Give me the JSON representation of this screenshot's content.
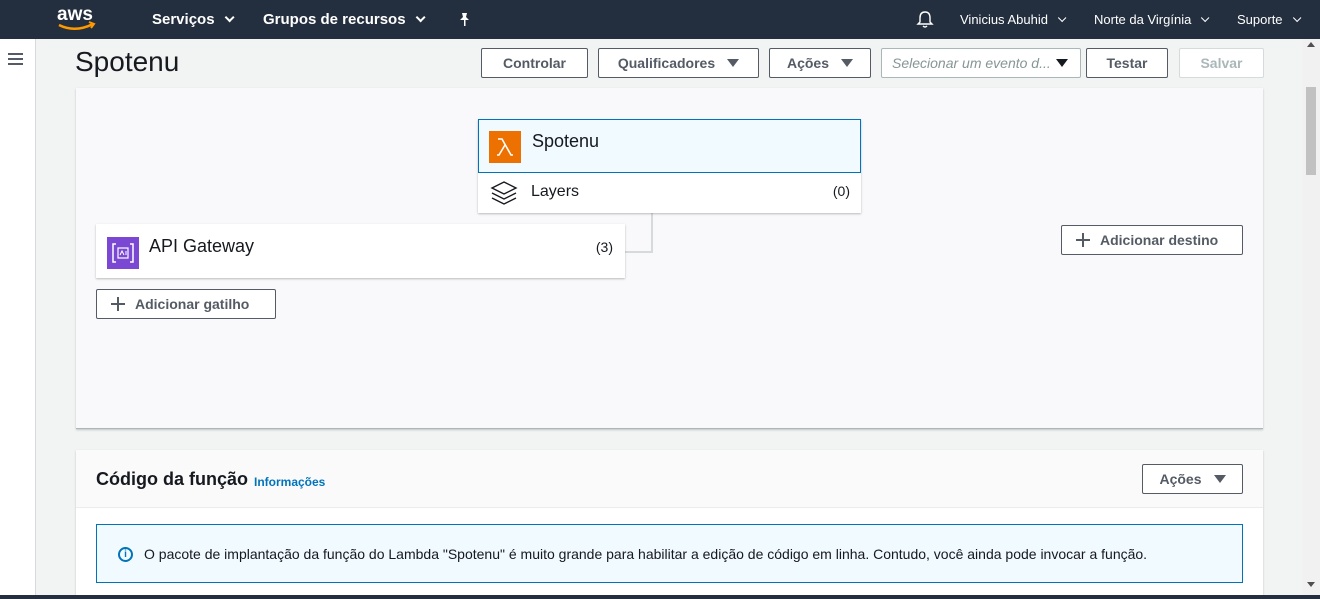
{
  "topbar": {
    "logo_text": "aws",
    "services_label": "Serviços",
    "resource_groups_label": "Grupos de recursos",
    "pin_icon": "pin-icon",
    "bell_icon": "bell-icon",
    "user_label": "Vinicius Abuhid",
    "region_label": "Norte da Virgínia",
    "support_label": "Suporte"
  },
  "header": {
    "title": "Spotenu",
    "buttons": {
      "throttle": "Controlar",
      "qualifiers": "Qualificadores",
      "actions": "Ações",
      "event_placeholder": "Selecionar um evento d...",
      "test": "Testar",
      "save": "Salvar"
    }
  },
  "designer": {
    "function_name": "Spotenu",
    "layers_label": "Layers",
    "layers_count": "(0)",
    "trigger_name": "API Gateway",
    "trigger_count": "(3)",
    "add_trigger_label": "Adicionar gatilho",
    "add_destination_label": "Adicionar destino",
    "colors": {
      "lambda": "#ed7100",
      "api_gateway": "#7b48d4",
      "selected_border": "#0073bb"
    }
  },
  "code_panel": {
    "title": "Código da função",
    "info_link": "Informações",
    "actions_label": "Ações",
    "alert_text": "O pacote de implantação da função do Lambda \"Spotenu\" é muito grande para habilitar a edição de código em linha. Contudo, você ainda pode invocar a função."
  }
}
